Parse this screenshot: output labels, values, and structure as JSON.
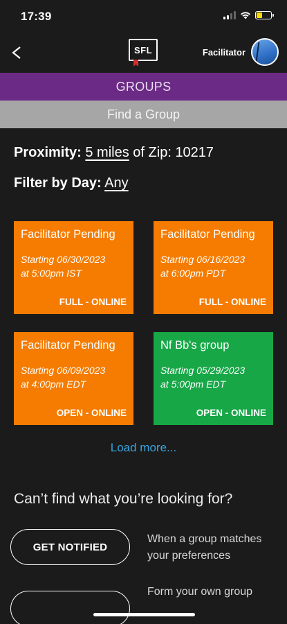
{
  "status_bar": {
    "time": "17:39"
  },
  "nav": {
    "logo_text": "SFL",
    "role_label": "Facilitator"
  },
  "header": {
    "section_title": "GROUPS",
    "sub_title": "Find a Group"
  },
  "filters": {
    "proximity_label": "Proximity:",
    "proximity_value": "5 miles",
    "proximity_of": "of Zip:",
    "zip": "10217",
    "day_label": "Filter by Day:",
    "day_value": "Any"
  },
  "groups": [
    {
      "title": "Facilitator Pending",
      "start": "Starting 06/30/2023",
      "time": "at 5:00pm  IST",
      "status": "FULL - ONLINE",
      "color": "#f57c00"
    },
    {
      "title": "Facilitator Pending",
      "start": "Starting 06/16/2023",
      "time": "at 6:00pm  PDT",
      "status": "FULL - ONLINE",
      "color": "#f57c00"
    },
    {
      "title": "Facilitator Pending",
      "start": "Starting 06/09/2023",
      "time": "at 4:00pm  EDT",
      "status": "OPEN - ONLINE",
      "color": "#f57c00"
    },
    {
      "title": "Nf Bb's group",
      "start": "Starting 05/29/2023",
      "time": "at 5:00pm  EDT",
      "status": "OPEN - ONLINE",
      "color": "#17a747"
    }
  ],
  "load_more": "Load more...",
  "cant_find": "Can’t find what you’re looking for?",
  "actions": {
    "get_notified_label": "GET NOTIFIED",
    "get_notified_desc_1": "When a group matches",
    "get_notified_desc_2": "your preferences",
    "form_group_desc": "Form your own group"
  },
  "colors": {
    "purple": "#6b2a86",
    "grey": "#a6a6a6",
    "orange": "#f57c00",
    "green": "#17a747",
    "link": "#36a3e0"
  }
}
